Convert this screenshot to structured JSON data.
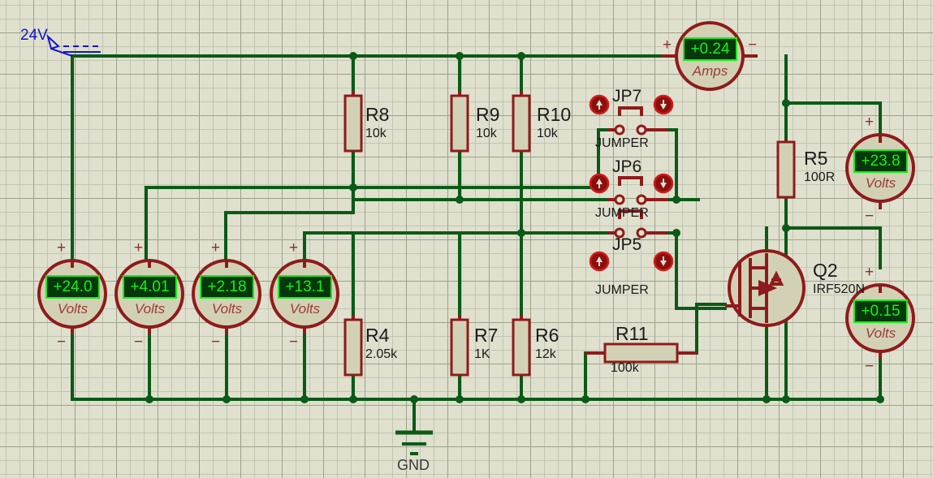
{
  "title": "Proteus Circuit Simulation Schematic",
  "source": {
    "label": "24V",
    "name": "dc-power-source"
  },
  "colors": {
    "wire": "#0b5a17",
    "component": "#8e1b1b",
    "component_fill": "#d2d1b5",
    "meter_outline": "#8e1b1b",
    "meter_display_bg": "#04380a",
    "meter_display_text": "#16ef16",
    "label_text": "#1b1b1b",
    "source_label": "#1414d2",
    "background": "#dfe0ce",
    "grid": "#9a9b82"
  },
  "resistors": [
    {
      "ref": "R8",
      "value": "10k",
      "orientation": "vertical"
    },
    {
      "ref": "R9",
      "value": "10k",
      "orientation": "vertical"
    },
    {
      "ref": "R10",
      "value": "10k",
      "orientation": "vertical"
    },
    {
      "ref": "R5",
      "value": "100R",
      "orientation": "vertical"
    },
    {
      "ref": "R4",
      "value": "2.05k",
      "orientation": "vertical"
    },
    {
      "ref": "R7",
      "value": "1K",
      "orientation": "vertical"
    },
    {
      "ref": "R6",
      "value": "12k",
      "orientation": "vertical"
    },
    {
      "ref": "R11",
      "value": "100k",
      "orientation": "horizontal"
    }
  ],
  "jumpers": [
    {
      "ref": "JP7",
      "type": "JUMPER"
    },
    {
      "ref": "JP6",
      "type": "JUMPER"
    },
    {
      "ref": "JP5",
      "type": "JUMPER"
    }
  ],
  "transistor": {
    "ref": "Q2",
    "part": "IRF520N",
    "type": "n-channel-mosfet"
  },
  "ground": {
    "label": "GND"
  },
  "meters": [
    {
      "name": "voltmeter-v1",
      "value": "+24.0",
      "unit": "Volts",
      "plus": "+",
      "minus": "−"
    },
    {
      "name": "voltmeter-v2",
      "value": "+4.01",
      "unit": "Volts",
      "plus": "+",
      "minus": "−"
    },
    {
      "name": "voltmeter-v3",
      "value": "+2.18",
      "unit": "Volts",
      "plus": "+",
      "minus": "−"
    },
    {
      "name": "voltmeter-v4",
      "value": "+13.1",
      "unit": "Volts",
      "plus": "+",
      "minus": "−"
    },
    {
      "name": "ammeter-a1",
      "value": "+0.24",
      "unit": "Amps",
      "plus": "+",
      "minus": "−"
    },
    {
      "name": "voltmeter-v5",
      "value": "+23.8",
      "unit": "Volts",
      "plus": "+",
      "minus": "−"
    },
    {
      "name": "voltmeter-v6",
      "value": "+0.15",
      "unit": "Volts",
      "plus": "+",
      "minus": "−"
    }
  ]
}
